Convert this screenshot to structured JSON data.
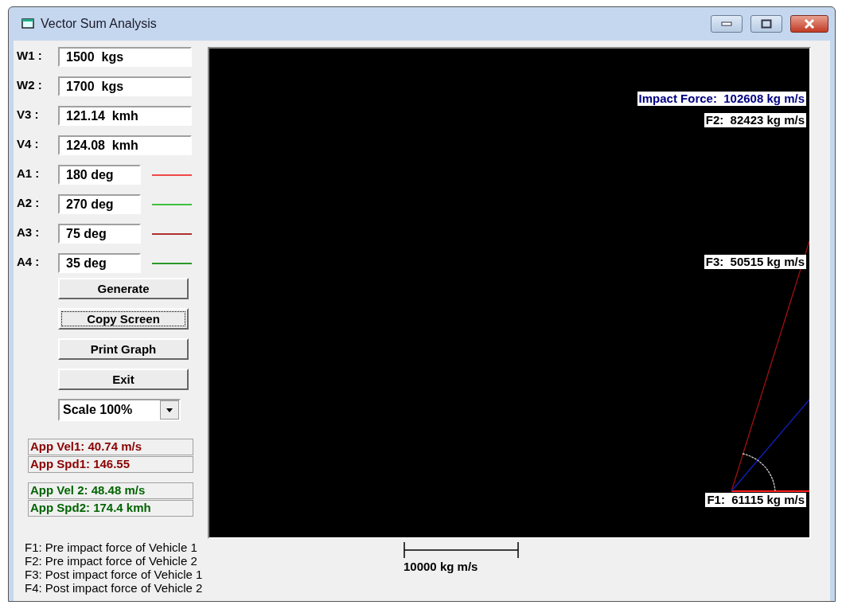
{
  "window": {
    "title": "Vector Sum Analysis"
  },
  "inputs": [
    {
      "label": "W1 :",
      "value": "1500  kgs",
      "kind": "wide"
    },
    {
      "label": "W2 :",
      "value": "1700  kgs",
      "kind": "wide"
    },
    {
      "label": "V3 :",
      "value": "121.14  kmh",
      "kind": "wide"
    },
    {
      "label": "V4 :",
      "value": "124.08  kmh",
      "kind": "wide"
    },
    {
      "label": "A1 :",
      "value": "180 deg",
      "kind": "angle",
      "color": "#f04848"
    },
    {
      "label": "A2 :",
      "value": "270 deg",
      "kind": "angle",
      "color": "#40c040"
    },
    {
      "label": "A3 :",
      "value": "75 deg",
      "kind": "angle",
      "color": "#b03030"
    },
    {
      "label": "A4 :",
      "value": "35 deg",
      "kind": "angle",
      "color": "#2a9a2a"
    }
  ],
  "buttons": [
    {
      "label": "Generate",
      "focused": false
    },
    {
      "label": "Copy Screen",
      "focused": true
    },
    {
      "label": "Print Graph",
      "focused": false
    },
    {
      "label": "Exit",
      "focused": false
    }
  ],
  "scale_dropdown": {
    "value": "Scale 100%"
  },
  "readout_groups": [
    {
      "color": "#8b0000",
      "lines": [
        "App Vel1: 40.74 m/s",
        "App Spd1: 146.55"
      ]
    },
    {
      "color": "#006400",
      "lines": [
        "App Vel 2: 48.48 m/s",
        "App Spd2: 174.4 kmh"
      ]
    }
  ],
  "canvas_labels": [
    {
      "kind": "impact",
      "text": "Impact Force:  102608 kg m/s",
      "color": "#000080"
    },
    {
      "kind": "f2",
      "text": "F2:  82423 kg m/s",
      "color": "#000000"
    },
    {
      "kind": "f3",
      "text": "F3:  50515 kg m/s",
      "color": "#000000"
    },
    {
      "kind": "f1",
      "text": "F1:  61115 kg m/s",
      "color": "#000000"
    }
  ],
  "legend": [
    "F1: Pre impact force of Vehicle 1",
    "F2: Pre impact force of Vehicle 2",
    "F3: Post impact force of Vehicle 1",
    "F4: Post impact force of Vehicle 2"
  ],
  "scale_bar": {
    "label": "10000 kg m/s"
  }
}
